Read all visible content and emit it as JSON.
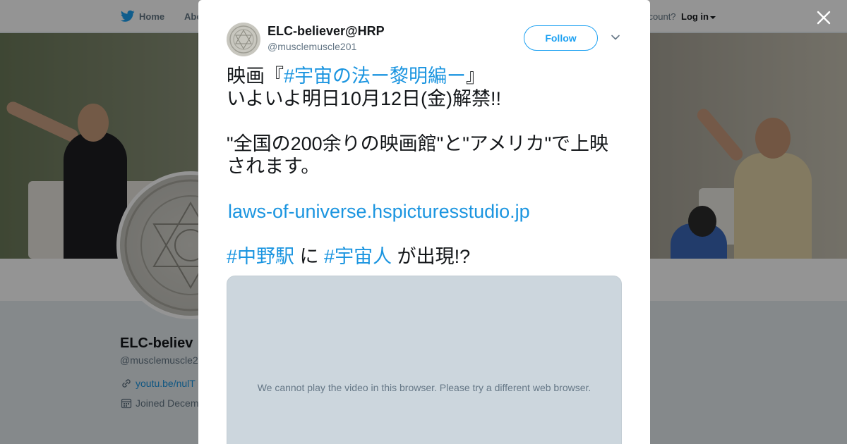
{
  "nav": {
    "home_label": "Home",
    "about_label": "Abo",
    "account_prompt": "ccount?",
    "login_label": "Log in"
  },
  "profile": {
    "name": "ELC-believ",
    "handle": "@musclemuscle2",
    "link": "youtu.be/nulT",
    "joined": "Joined Decem"
  },
  "tweet": {
    "author_name": "ELC-believer@HRP",
    "author_handle": "@musclemuscle201",
    "follow_label": "Follow",
    "text": {
      "line1_prefix": "映画『",
      "line1_hashtag": "#宇宙の法ー黎明編ー",
      "line1_suffix": "』",
      "line2": "いよいよ明日10月12日(金)解禁!!",
      "line3": "\"全国の200余りの映画館\"と\"アメリカ\"で上映",
      "line4": "されます。",
      "link": "laws-of-universe.hspicturesstudio.jp",
      "hashtag_station": "#中野駅",
      "connector": " に ",
      "hashtag_alien": "#宇宙人",
      "ending": " が出現!?"
    },
    "media_message": "We cannot play the video in this browser. Please try a different web browser."
  },
  "colors": {
    "accent": "#1da1f2",
    "link": "#1b95e0",
    "text": "#14171a",
    "muted": "#657786",
    "media_bg": "#ccd6dd"
  },
  "icons": [
    "twitter-bird-icon",
    "close-icon",
    "chevron-down-icon",
    "link-icon",
    "calendar-icon"
  ]
}
